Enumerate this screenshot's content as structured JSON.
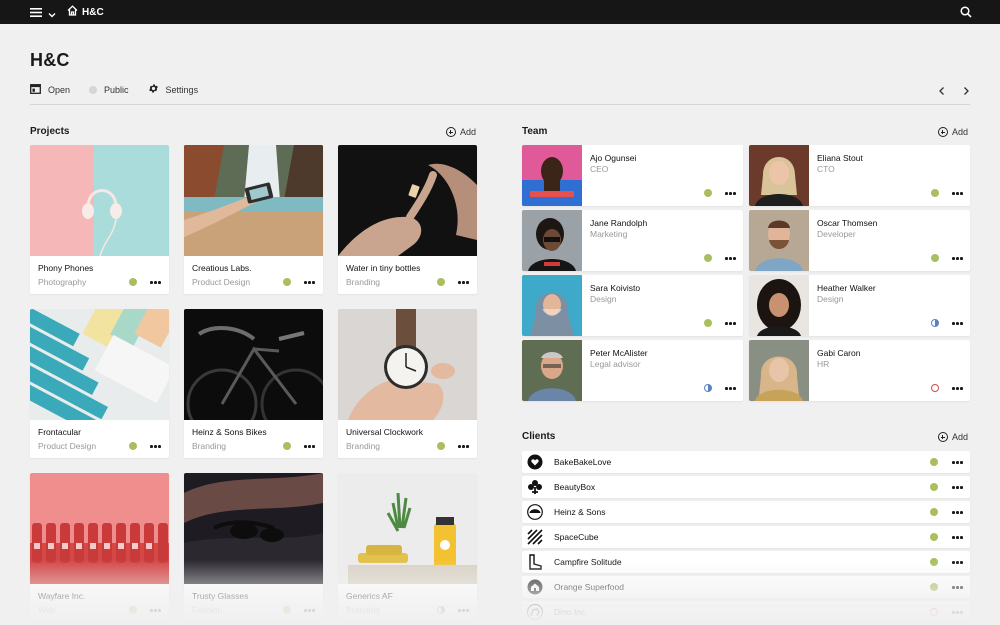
{
  "topbar": {
    "home_label": "H&C"
  },
  "header": {
    "title": "H&C",
    "toolbar": {
      "open": "Open",
      "public": "Public",
      "settings": "Settings"
    }
  },
  "projects": {
    "title": "Projects",
    "add_label": "Add",
    "items": [
      {
        "name": "Phony Phones",
        "category": "Photography",
        "status": "active"
      },
      {
        "name": "Creatious Labs.",
        "category": "Product Design",
        "status": "active"
      },
      {
        "name": "Water in tiny bottles",
        "category": "Branding",
        "status": "active"
      },
      {
        "name": "Frontacular",
        "category": "Product Design",
        "status": "active"
      },
      {
        "name": "Heinz & Sons Bikes",
        "category": "Branding",
        "status": "active"
      },
      {
        "name": "Universal Clockwork",
        "category": "Branding",
        "status": "active"
      },
      {
        "name": "Wayfare Inc.",
        "category": "Web",
        "status": "active"
      },
      {
        "name": "Trusty Glasses",
        "category": "Fashion",
        "status": "active"
      },
      {
        "name": "Generics AF",
        "category": "Branding",
        "status": "partial"
      }
    ]
  },
  "team": {
    "title": "Team",
    "add_label": "Add",
    "members": [
      {
        "name": "Ajo Ogunsei",
        "role": "CEO",
        "status": "active"
      },
      {
        "name": "Eliana Stout",
        "role": "CTO",
        "status": "active"
      },
      {
        "name": "Jane Randolph",
        "role": "Marketing",
        "status": "active"
      },
      {
        "name": "Oscar Thomsen",
        "role": "Developer",
        "status": "active"
      },
      {
        "name": "Sara Koivisto",
        "role": "Design",
        "status": "active"
      },
      {
        "name": "Heather Walker",
        "role": "Design",
        "status": "partial"
      },
      {
        "name": "Peter McAlister",
        "role": "Legal advisor",
        "status": "partial"
      },
      {
        "name": "Gabi Caron",
        "role": "HR",
        "status": "inactive"
      }
    ]
  },
  "clients": {
    "title": "Clients",
    "add_label": "Add",
    "items": [
      {
        "name": "BakeBakeLove",
        "logo": "heart-logo-icon",
        "status": "active"
      },
      {
        "name": "BeautyBox",
        "logo": "flower-logo-icon",
        "status": "active"
      },
      {
        "name": "Heinz & Sons",
        "logo": "dome-logo-icon",
        "status": "active"
      },
      {
        "name": "SpaceCube",
        "logo": "stripes-logo-icon",
        "status": "active"
      },
      {
        "name": "Campfire Solitude",
        "logo": "boot-logo-icon",
        "status": "active"
      },
      {
        "name": "Orange Superfood",
        "logo": "house-logo-icon",
        "status": "active"
      },
      {
        "name": "Dino Inc.",
        "logo": "dino-logo-icon",
        "status": "inactive"
      }
    ]
  },
  "colors": {
    "topbar": "#161616",
    "background": "#f0f0f0",
    "status_active": "#a9bf5f",
    "status_partial": "#5b80c5",
    "status_inactive": "#d24b4b"
  }
}
